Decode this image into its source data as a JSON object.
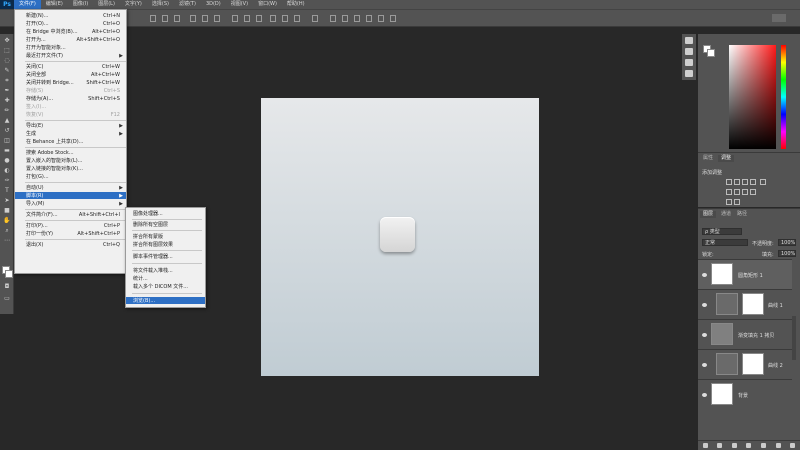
{
  "app": {
    "logo": "Ps"
  },
  "menubar": {
    "items": [
      "文件(F)",
      "编辑(E)",
      "图像(I)",
      "图层(L)",
      "文字(Y)",
      "选择(S)",
      "滤镜(T)",
      "3D(D)",
      "视图(V)",
      "窗口(W)",
      "帮助(H)"
    ]
  },
  "file_menu": {
    "items": [
      {
        "label": "新建(N)...",
        "shortcut": "Ctrl+N"
      },
      {
        "label": "打开(O)...",
        "shortcut": "Ctrl+O"
      },
      {
        "label": "在 Bridge 中浏览(B)...",
        "shortcut": "Alt+Ctrl+O"
      },
      {
        "label": "打开为...",
        "shortcut": "Alt+Shift+Ctrl+O"
      },
      {
        "label": "打开为智能对象...",
        "shortcut": ""
      },
      {
        "label": "最近打开文件(T)",
        "shortcut": ""
      },
      {
        "label": "关闭(C)",
        "shortcut": "Ctrl+W"
      },
      {
        "label": "关闭全部",
        "shortcut": "Alt+Ctrl+W"
      },
      {
        "label": "关闭并转到 Bridge...",
        "shortcut": "Shift+Ctrl+W"
      },
      {
        "label": "存储(S)",
        "shortcut": "Ctrl+S"
      },
      {
        "label": "存储为(A)...",
        "shortcut": "Shift+Ctrl+S"
      },
      {
        "label": "签入(I)...",
        "shortcut": ""
      },
      {
        "label": "恢复(V)",
        "shortcut": "F12"
      },
      {
        "label": "导出(E)",
        "shortcut": ""
      },
      {
        "label": "生成",
        "shortcut": ""
      },
      {
        "label": "在 Behance 上共享(D)...",
        "shortcut": ""
      },
      {
        "label": "搜索 Adobe Stock...",
        "shortcut": ""
      },
      {
        "label": "置入嵌入的智能对象(L)...",
        "shortcut": ""
      },
      {
        "label": "置入链接的智能对象(K)...",
        "shortcut": ""
      },
      {
        "label": "打包(G)...",
        "shortcut": ""
      },
      {
        "label": "自动(U)",
        "shortcut": ""
      },
      {
        "label": "脚本(R)",
        "shortcut": ""
      },
      {
        "label": "导入(M)",
        "shortcut": ""
      },
      {
        "label": "文件简介(F)...",
        "shortcut": "Alt+Shift+Ctrl+I"
      },
      {
        "label": "打印(P)...",
        "shortcut": "Ctrl+P"
      },
      {
        "label": "打印一份(Y)",
        "shortcut": "Alt+Shift+Ctrl+P"
      },
      {
        "label": "退出(X)",
        "shortcut": "Ctrl+Q"
      }
    ]
  },
  "script_menu": {
    "items": [
      "图像处理器...",
      "删除所有空图层",
      "拼合所有蒙版",
      "拼合所有图层效果",
      "脚本事件管理器...",
      "将文件载入堆栈...",
      "统计...",
      "载入多个 DICOM 文件...",
      "浏览(B)..."
    ]
  },
  "adjustments": {
    "tabs": [
      "属性",
      "调整"
    ],
    "title": "添加调整"
  },
  "layers": {
    "tabs": [
      "图层",
      "通道",
      "路径"
    ],
    "filter": "ρ 类型",
    "blend_mode": "正常",
    "opacity_label": "不透明度:",
    "opacity_value": "100%",
    "lock_label": "锁定:",
    "fill_label": "填充:",
    "fill_value": "100%",
    "items": [
      {
        "name": "圆角矩形 1",
        "selected": true
      },
      {
        "name": "曲线 1",
        "selected": false
      },
      {
        "name": "渐变填充 1 拷贝",
        "selected": false
      },
      {
        "name": "曲线 2",
        "selected": false
      },
      {
        "name": "背景",
        "selected": false
      }
    ]
  },
  "colors": {
    "accent": "#2d6fc4",
    "canvas_top": "#e6e8ea",
    "canvas_bottom": "#c0ccd3",
    "panel": "#535353",
    "workspace": "#282828"
  }
}
